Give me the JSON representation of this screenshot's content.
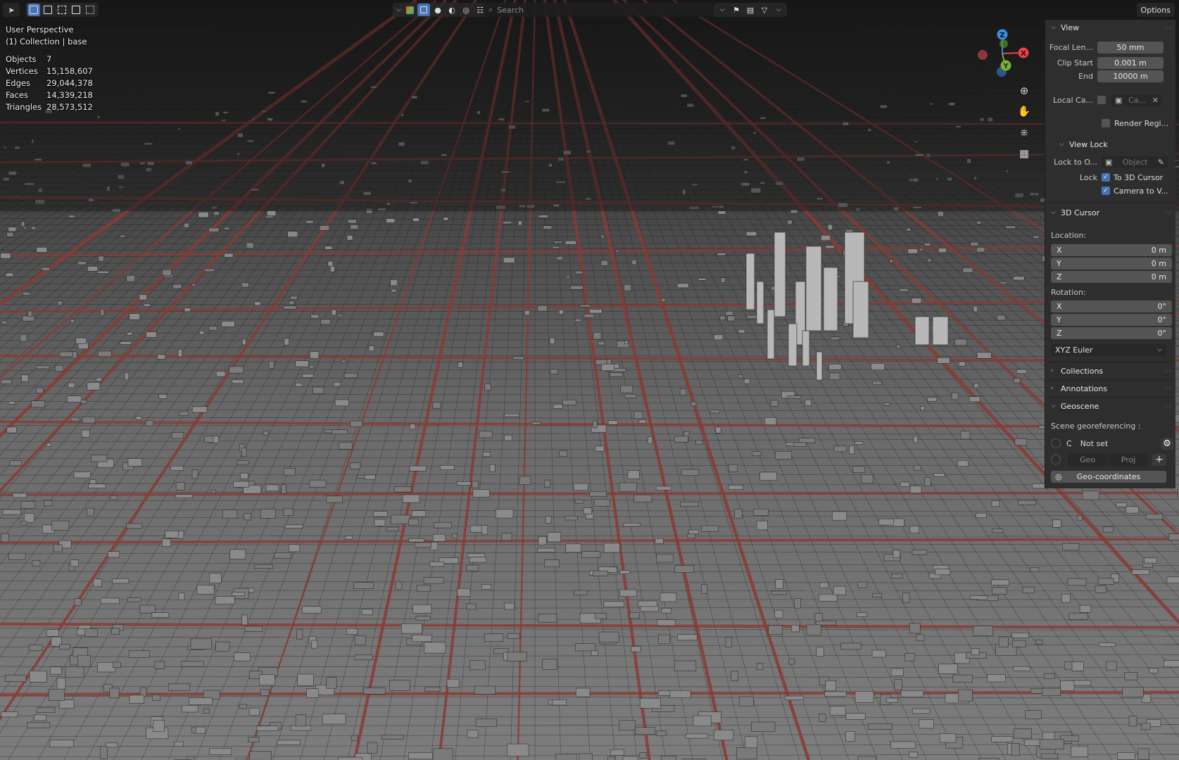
{
  "header": {
    "search_placeholder": "Search",
    "options_label": "Options"
  },
  "overlay": {
    "view_name": "User Perspective",
    "collection_line": "(1) Collection | base",
    "stats": [
      {
        "label": "Objects",
        "value": "7"
      },
      {
        "label": "Vertices",
        "value": "15,158,607"
      },
      {
        "label": "Edges",
        "value": "29,044,378"
      },
      {
        "label": "Faces",
        "value": "14,339,218"
      },
      {
        "label": "Triangles",
        "value": "28,573,512"
      }
    ]
  },
  "gizmo": {
    "x_label": "X",
    "y_label": "Y",
    "z_label": "Z"
  },
  "sidebar": {
    "view": {
      "title": "View",
      "focal_length_label": "Focal Len...",
      "focal_length_value": "50 mm",
      "clip_start_label": "Clip Start",
      "clip_start_value": "0.001 m",
      "clip_end_label": "End",
      "clip_end_value": "10000 m",
      "local_camera_label": "Local Ca...",
      "local_camera_value": "Ca...",
      "render_region_label": "Render Regi..."
    },
    "view_lock": {
      "title": "View Lock",
      "lock_to_object_label": "Lock to O...",
      "lock_to_object_placeholder": "Object",
      "lock_label": "Lock",
      "to_3d_cursor_label": "To 3D Cursor",
      "camera_to_view_label": "Camera to V..."
    },
    "cursor": {
      "title": "3D Cursor",
      "location_label": "Location:",
      "location": [
        {
          "axis": "X",
          "value": "0 m"
        },
        {
          "axis": "Y",
          "value": "0 m"
        },
        {
          "axis": "Z",
          "value": "0 m"
        }
      ],
      "rotation_label": "Rotation:",
      "rotation": [
        {
          "axis": "X",
          "value": "0°"
        },
        {
          "axis": "Y",
          "value": "0°"
        },
        {
          "axis": "Z",
          "value": "0°"
        }
      ],
      "rotation_mode": "XYZ Euler"
    },
    "collections_title": "Collections",
    "annotations_title": "Annotations",
    "geoscene": {
      "title": "Geoscene",
      "georef_label": "Scene georeferencing :",
      "crs_letter": "C",
      "crs_value": "Not set",
      "geo_label": "Geo",
      "proj_label": "Proj",
      "geocoords_label": "Geo-coordinates"
    }
  },
  "colors": {
    "accent": "#4772b3",
    "road": "#8a3a34",
    "axis_x": "#e8434e",
    "axis_y": "#79b231",
    "axis_z": "#3a8ee6"
  }
}
